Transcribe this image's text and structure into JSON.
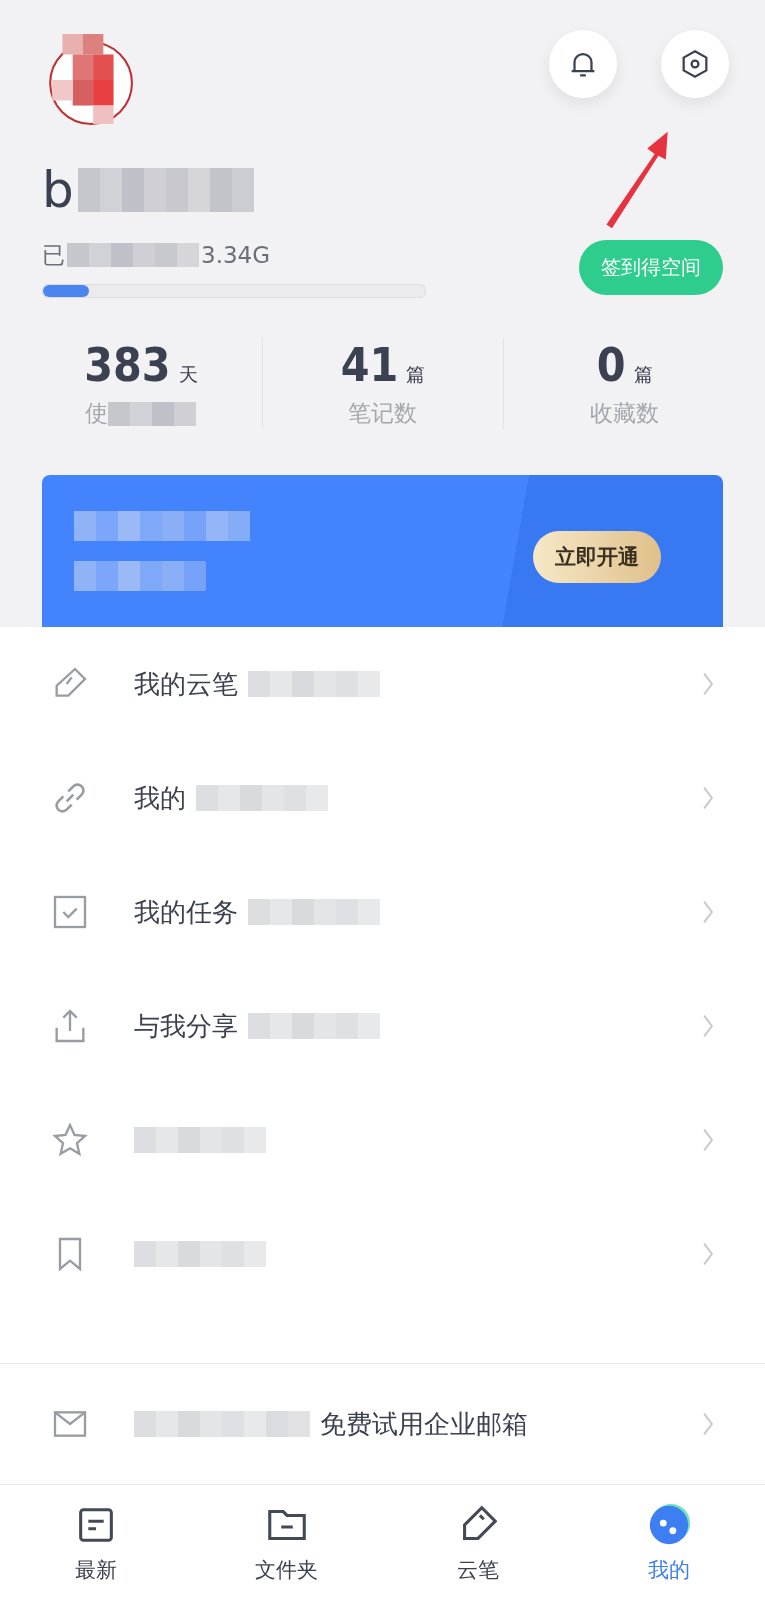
{
  "header": {
    "username": "b",
    "storage_prefix": "已",
    "storage_total": "3.34G",
    "storage": {
      "level": 0.12
    },
    "checkin_button": "签到得空间"
  },
  "stats": [
    {
      "value": "383",
      "unit": "天",
      "label": "使"
    },
    {
      "value": "41",
      "unit": "篇",
      "label": "笔记数"
    },
    {
      "value": "0",
      "unit": "篇",
      "label": "收藏数"
    }
  ],
  "banner": {
    "button": "立即开通"
  },
  "menu": [
    {
      "kind": "pencil",
      "label": "我的云笔"
    },
    {
      "kind": "link",
      "label": "我的"
    },
    {
      "kind": "check",
      "label": "我的任务"
    },
    {
      "kind": "share",
      "label": "与我分享"
    },
    {
      "kind": "star"
    },
    {
      "kind": "bookmark"
    }
  ],
  "mail_item": {
    "kind": "mail",
    "label": "免费试用企业邮箱"
  },
  "tabs": [
    {
      "kind": "note",
      "label": "最新",
      "selected": false
    },
    {
      "kind": "folder",
      "label": "文件夹",
      "selected": false
    },
    {
      "kind": "pen",
      "label": "云笔",
      "selected": false
    },
    {
      "kind": "avatar",
      "label": "我的",
      "selected": true
    }
  ]
}
